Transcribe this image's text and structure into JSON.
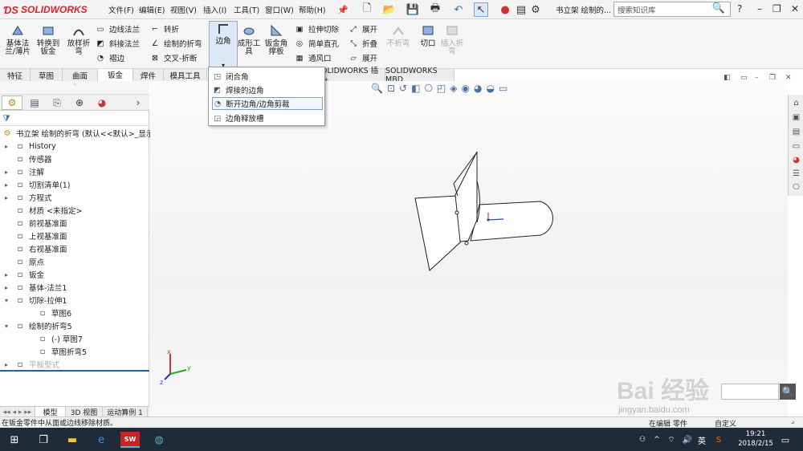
{
  "app": {
    "logo": "SOLIDWORKS",
    "doc_title": "书立架 绘制的..."
  },
  "menu": [
    "文件(F)",
    "编辑(E)",
    "视图(V)",
    "插入(I)",
    "工具(T)",
    "窗口(W)",
    "帮助(H)"
  ],
  "search": {
    "placeholder": "搜索知识库"
  },
  "ribbon": {
    "big": [
      {
        "label": "基体法\n兰/薄片",
        "icon": "base-flange-icon"
      },
      {
        "label": "转换到\n钣金",
        "icon": "convert-sheetmetal-icon"
      },
      {
        "label": "放样折\n弯",
        "icon": "lofted-bend-icon"
      },
      {
        "label": "边角",
        "icon": "corner-icon"
      },
      {
        "label": "成形工\n具",
        "icon": "forming-tool-icon"
      },
      {
        "label": "钣金角\n撑板",
        "icon": "gusset-icon"
      },
      {
        "label": "不折弯",
        "icon": "unbend-icon"
      },
      {
        "label": "切口",
        "icon": "rip-icon"
      },
      {
        "label": "插入折\n弯",
        "icon": "insert-bends-icon"
      }
    ],
    "small": [
      {
        "label": "边线法兰",
        "icon": "edge-flange-icon"
      },
      {
        "label": "斜接法兰",
        "icon": "miter-flange-icon"
      },
      {
        "label": "褶边",
        "icon": "hem-icon"
      },
      {
        "label": "转折",
        "icon": "jog-icon"
      },
      {
        "label": "绘制的折弯",
        "icon": "sketched-bend-icon"
      },
      {
        "label": "交叉-折断",
        "icon": "cross-break-icon"
      },
      {
        "label": "拉伸切除",
        "icon": "extruded-cut-icon"
      },
      {
        "label": "简单直孔",
        "icon": "simple-hole-icon"
      },
      {
        "label": "通风口",
        "icon": "vent-icon"
      },
      {
        "label": "展开",
        "icon": "unfold-icon"
      },
      {
        "label": "折叠",
        "icon": "fold-icon"
      },
      {
        "label": "展开",
        "icon": "flatten-icon"
      }
    ]
  },
  "tabs": [
    "特征",
    "草图",
    "曲面",
    "钣金",
    "焊件",
    "模具工具"
  ],
  "tabs_right": [
    "OLIDWORKS 插件",
    "SOLIDWORKS MBD"
  ],
  "dropdown": [
    "闭合角",
    "焊接的边角",
    "断开边角/边角剪裁",
    "边角释放槽"
  ],
  "tree": {
    "root": "书立架 绘制的折弯 (默认<<默认>_显示状",
    "items": [
      {
        "label": "History",
        "arrow": "▸",
        "icon": "history-icon"
      },
      {
        "label": "传感器",
        "arrow": "",
        "icon": "sensor-icon"
      },
      {
        "label": "注解",
        "arrow": "▸",
        "icon": "annotation-icon"
      },
      {
        "label": "切割清单(1)",
        "arrow": "▸",
        "icon": "cutlist-icon"
      },
      {
        "label": "方程式",
        "arrow": "▸",
        "icon": "equation-icon"
      },
      {
        "label": "材质 <未指定>",
        "arrow": "",
        "icon": "material-icon"
      },
      {
        "label": "前视基准面",
        "arrow": "",
        "icon": "plane-icon"
      },
      {
        "label": "上视基准面",
        "arrow": "",
        "icon": "plane-icon"
      },
      {
        "label": "右视基准面",
        "arrow": "",
        "icon": "plane-icon"
      },
      {
        "label": "原点",
        "arrow": "",
        "icon": "origin-icon"
      },
      {
        "label": "钣金",
        "arrow": "▸",
        "icon": "sheetmetal-icon"
      },
      {
        "label": "基体-法兰1",
        "arrow": "▸",
        "icon": "base-flange-icon"
      },
      {
        "label": "切除-拉伸1",
        "arrow": "▾",
        "icon": "cut-extrude-icon"
      },
      {
        "label": "草图6",
        "arrow": "",
        "icon": "sketch-icon"
      },
      {
        "label": "绘制的折弯5",
        "arrow": "▾",
        "icon": "sketched-bend-icon"
      },
      {
        "label": "(-) 草图7",
        "arrow": "",
        "icon": "sketch-icon"
      },
      {
        "label": "草图折弯5",
        "arrow": "",
        "icon": "bend-icon"
      },
      {
        "label": "平板型式",
        "arrow": "▸",
        "icon": "flat-pattern-icon"
      }
    ]
  },
  "bottom_tabs": [
    "模型",
    "3D 视图",
    "运动算例 1"
  ],
  "status": "在钣金零件中从面或边线移除材质。",
  "status_right": [
    "在编辑 零件",
    "自定义"
  ],
  "clock": {
    "time": "19:21",
    "date": "2018/2/15"
  },
  "tray": {
    "lang": "英"
  },
  "watermark": {
    "text": "Bai 经验",
    "url": "jingyan.baidu.com"
  }
}
